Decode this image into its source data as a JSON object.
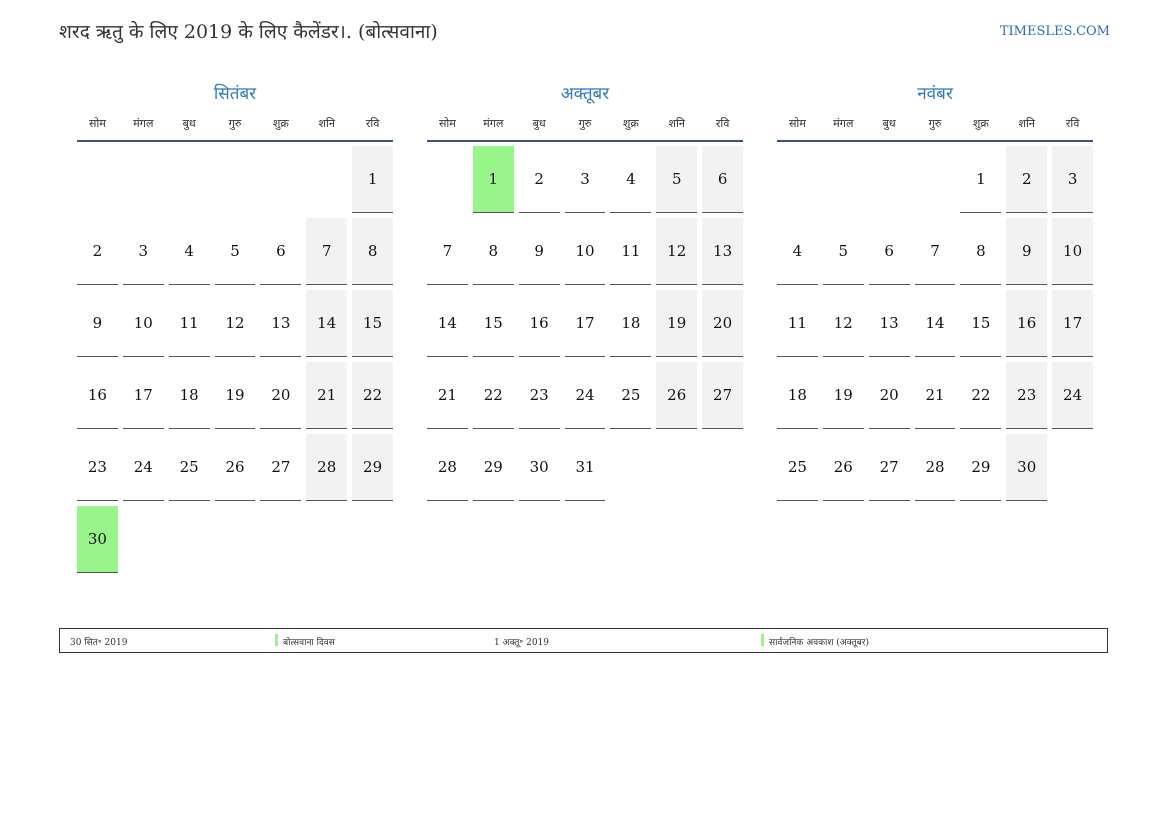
{
  "header": {
    "title": "शरद ऋतु के लिए 2019 के लिए कैलेंडर।. (बोत्सवाना)",
    "site": "TIMESLES.COM"
  },
  "weekdays": [
    "सोम",
    "मंगल",
    "बुध",
    "गुरु",
    "शुक्र",
    "शनि",
    "रवि"
  ],
  "months": [
    {
      "name": "सितंबर",
      "weeks": [
        [
          "",
          "",
          "",
          "",
          "",
          "",
          "1"
        ],
        [
          "2",
          "3",
          "4",
          "5",
          "6",
          "7",
          "8"
        ],
        [
          "9",
          "10",
          "11",
          "12",
          "13",
          "14",
          "15"
        ],
        [
          "16",
          "17",
          "18",
          "19",
          "20",
          "21",
          "22"
        ],
        [
          "23",
          "24",
          "25",
          "26",
          "27",
          "28",
          "29"
        ],
        [
          "30",
          "",
          "",
          "",
          "",
          "",
          ""
        ]
      ],
      "holidays": [
        "30"
      ]
    },
    {
      "name": "अक्तूबर",
      "weeks": [
        [
          "",
          "1",
          "2",
          "3",
          "4",
          "5",
          "6"
        ],
        [
          "7",
          "8",
          "9",
          "10",
          "11",
          "12",
          "13"
        ],
        [
          "14",
          "15",
          "16",
          "17",
          "18",
          "19",
          "20"
        ],
        [
          "21",
          "22",
          "23",
          "24",
          "25",
          "26",
          "27"
        ],
        [
          "28",
          "29",
          "30",
          "31",
          "",
          "",
          ""
        ]
      ],
      "holidays": [
        "1"
      ]
    },
    {
      "name": "नवंबर",
      "weeks": [
        [
          "",
          "",
          "",
          "",
          "1",
          "2",
          "3"
        ],
        [
          "4",
          "5",
          "6",
          "7",
          "8",
          "9",
          "10"
        ],
        [
          "11",
          "12",
          "13",
          "14",
          "15",
          "16",
          "17"
        ],
        [
          "18",
          "19",
          "20",
          "21",
          "22",
          "23",
          "24"
        ],
        [
          "25",
          "26",
          "27",
          "28",
          "29",
          "30",
          ""
        ]
      ],
      "holidays": []
    }
  ],
  "legend": [
    {
      "date": "30 सित॰ 2019",
      "name": "बोत्सवाना दिवस"
    },
    {
      "date": "1 अक्तू॰ 2019",
      "name": "सार्वजनिक अवकाश (अक्तूबर)"
    }
  ],
  "colors": {
    "holiday": "#98f589",
    "weekend": "#f2f2f2",
    "month_title": "#2e7ac0",
    "link": "#2a6ebb"
  }
}
